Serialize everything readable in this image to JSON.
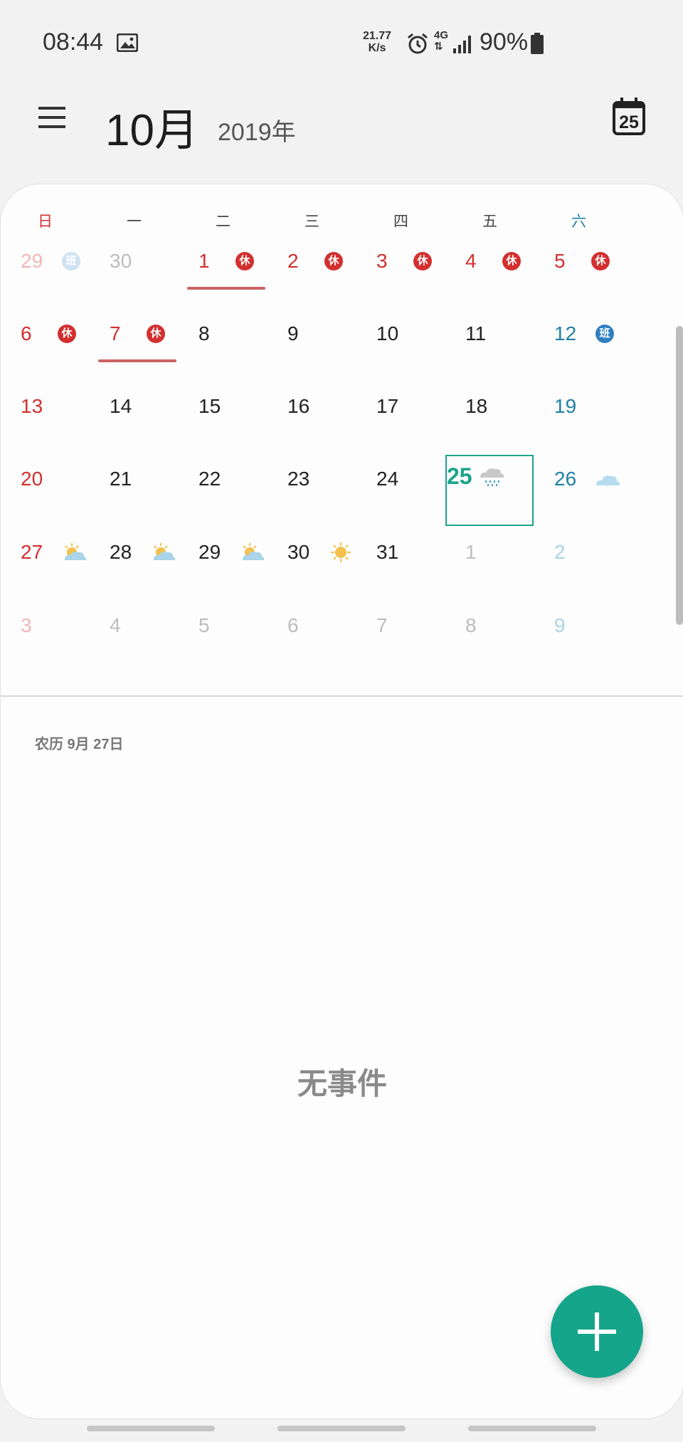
{
  "status_bar": {
    "time": "08:44",
    "net_speed_value": "21.77",
    "net_speed_unit": "K/s",
    "net_type": "4G",
    "battery": "90%"
  },
  "header": {
    "month": "10月",
    "year": "2019年",
    "today_day": "25"
  },
  "weekdays": [
    "日",
    "一",
    "二",
    "三",
    "四",
    "五",
    "六"
  ],
  "calendar_rows": [
    [
      {
        "d": "29",
        "badge": "班",
        "faded": true
      },
      {
        "d": "30",
        "faded": true
      },
      {
        "d": "1",
        "badge": "休",
        "underline": true
      },
      {
        "d": "2",
        "badge": "休"
      },
      {
        "d": "3",
        "badge": "休"
      },
      {
        "d": "4",
        "badge": "休"
      },
      {
        "d": "5",
        "badge": "休"
      }
    ],
    [
      {
        "d": "6",
        "badge": "休"
      },
      {
        "d": "7",
        "badge": "休",
        "underline": true
      },
      {
        "d": "8"
      },
      {
        "d": "9"
      },
      {
        "d": "10"
      },
      {
        "d": "11"
      },
      {
        "d": "12",
        "badge": "班"
      }
    ],
    [
      {
        "d": "13"
      },
      {
        "d": "14"
      },
      {
        "d": "15"
      },
      {
        "d": "16"
      },
      {
        "d": "17"
      },
      {
        "d": "18"
      },
      {
        "d": "19"
      }
    ],
    [
      {
        "d": "20"
      },
      {
        "d": "21"
      },
      {
        "d": "22"
      },
      {
        "d": "23"
      },
      {
        "d": "24"
      },
      {
        "d": "25",
        "weather": "rain-cloud-icon",
        "selected": true
      },
      {
        "d": "26",
        "weather": "cloud-icon"
      }
    ],
    [
      {
        "d": "27",
        "weather": "partly-sunny-icon"
      },
      {
        "d": "28",
        "weather": "partly-sunny-icon"
      },
      {
        "d": "29",
        "weather": "partly-sunny-icon"
      },
      {
        "d": "30",
        "weather": "sun-icon"
      },
      {
        "d": "31"
      },
      {
        "d": "1",
        "faded": true
      },
      {
        "d": "2",
        "faded": true
      }
    ],
    [
      {
        "d": "3",
        "faded": true
      },
      {
        "d": "4",
        "faded": true
      },
      {
        "d": "5",
        "faded": true
      },
      {
        "d": "6",
        "faded": true
      },
      {
        "d": "7",
        "faded": true
      },
      {
        "d": "8",
        "faded": true
      },
      {
        "d": "9",
        "faded": true
      }
    ]
  ],
  "colors": {
    "sunday": "#d32f2f",
    "saturday": "#1f7fa6",
    "weekday": "#222222",
    "holiday": "#d32f2f",
    "selected": "#1aa58b",
    "faded_sunday": "#f0b6b6",
    "faded_saturday": "#a9d4e2",
    "faded_weekday": "#bdbdbd",
    "accent": "#15a58a"
  },
  "detail": {
    "lunar_date": "农历 9月 27日",
    "empty_text": "无事件"
  },
  "icons": {
    "menu": "hamburger-menu-icon",
    "today": "calendar-today-icon",
    "add": "plus-icon"
  }
}
